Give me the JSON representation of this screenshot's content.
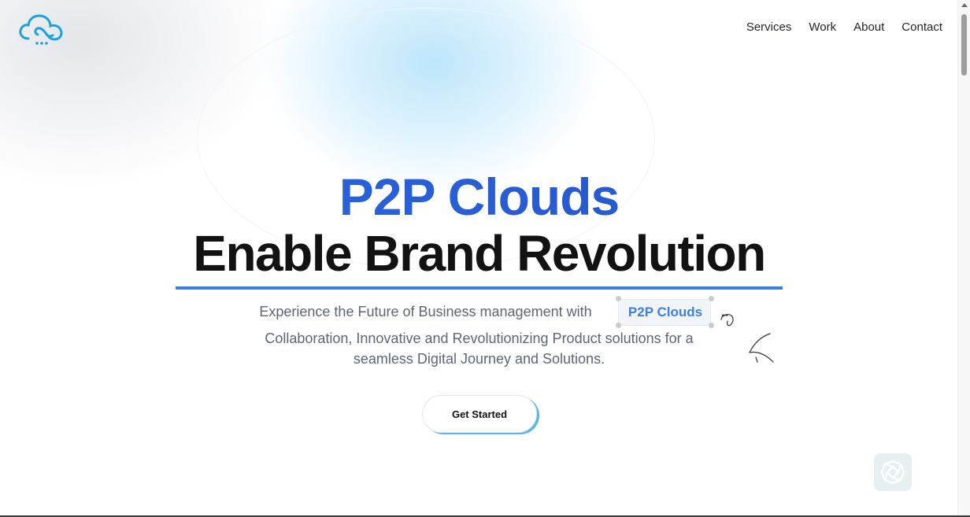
{
  "nav": {
    "items": [
      {
        "label": "Services"
      },
      {
        "label": "Work"
      },
      {
        "label": "About"
      },
      {
        "label": "Contact"
      }
    ]
  },
  "hero": {
    "title_line1": "P2P Clouds",
    "title_line2": "Enable Brand Revolution",
    "subtitle_line1": "Experience the Future of Business management with",
    "highlight": "P2P Clouds",
    "subtitle_line2": "Collaboration, Innovative and Revolutionizing Product solutions for a",
    "subtitle_line3": "seamless Digital Journey and Solutions.",
    "cta_label": "Get Started"
  },
  "colors": {
    "brand_blue": "#2e63d8",
    "accent_blue": "#3a7fe0",
    "logo_blue": "#1aa3dc",
    "cta_shadow": "#5ab9e4",
    "heading_dark": "#121212",
    "body_gray": "#5d6674"
  },
  "icons": {
    "logo": "cloud-logo-icon",
    "doodle": "hand-drawn-arrow-icon",
    "widget": "chat-widget-icon"
  }
}
